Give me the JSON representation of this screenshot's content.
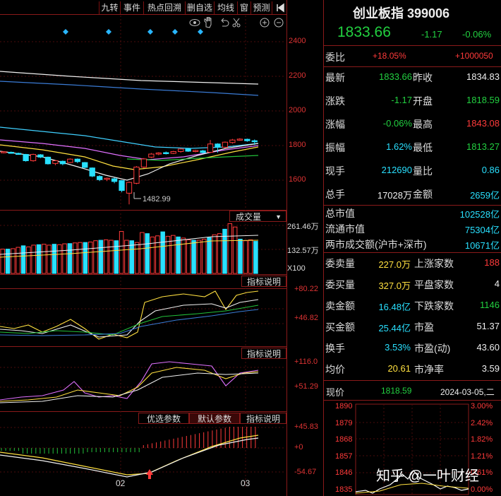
{
  "toolbar": {
    "items": [
      "九转",
      "事件",
      "热点回溯",
      "删自选",
      "均线",
      "窗",
      "预测"
    ],
    "collapse_icon": "panel-collapse-icon"
  },
  "chart_tools": [
    "eye-icon",
    "hand-icon",
    "undo-icon",
    "scissors-icon",
    "zoom-in-icon",
    "zoom-out-icon"
  ],
  "chart_data": [
    {
      "type": "candlestick",
      "title": "",
      "y_ticks": [
        "2400",
        "2200",
        "2000",
        "1800",
        "1600"
      ],
      "ylim": [
        1480,
        2460
      ],
      "low_annotation": "1482.99",
      "candles": [
        {
          "o": 1770,
          "c": 1775,
          "h": 1778,
          "l": 1766
        },
        {
          "o": 1772,
          "c": 1768,
          "h": 1776,
          "l": 1764
        },
        {
          "o": 1766,
          "c": 1762,
          "h": 1770,
          "l": 1758
        },
        {
          "o": 1760,
          "c": 1725,
          "h": 1763,
          "l": 1720
        },
        {
          "o": 1725,
          "c": 1760,
          "h": 1764,
          "l": 1720
        },
        {
          "o": 1758,
          "c": 1745,
          "h": 1762,
          "l": 1740
        },
        {
          "o": 1745,
          "c": 1708,
          "h": 1748,
          "l": 1704
        },
        {
          "o": 1710,
          "c": 1725,
          "h": 1728,
          "l": 1700
        },
        {
          "o": 1722,
          "c": 1708,
          "h": 1726,
          "l": 1700
        },
        {
          "o": 1715,
          "c": 1734,
          "h": 1738,
          "l": 1712
        },
        {
          "o": 1734,
          "c": 1720,
          "h": 1738,
          "l": 1712
        },
        {
          "o": 1715,
          "c": 1688,
          "h": 1718,
          "l": 1684
        },
        {
          "o": 1685,
          "c": 1640,
          "h": 1688,
          "l": 1634
        },
        {
          "o": 1638,
          "c": 1620,
          "h": 1645,
          "l": 1612
        },
        {
          "o": 1622,
          "c": 1628,
          "h": 1632,
          "l": 1612
        },
        {
          "o": 1625,
          "c": 1610,
          "h": 1632,
          "l": 1600
        },
        {
          "o": 1615,
          "c": 1560,
          "h": 1618,
          "l": 1550
        },
        {
          "o": 1545,
          "c": 1605,
          "h": 1610,
          "l": 1483
        },
        {
          "o": 1600,
          "c": 1690,
          "h": 1695,
          "l": 1595
        },
        {
          "o": 1690,
          "c": 1735,
          "h": 1740,
          "l": 1684
        },
        {
          "o": 1745,
          "c": 1762,
          "h": 1768,
          "l": 1740
        },
        {
          "o": 1762,
          "c": 1768,
          "h": 1772,
          "l": 1756
        },
        {
          "o": 1770,
          "c": 1766,
          "h": 1776,
          "l": 1760
        },
        {
          "o": 1766,
          "c": 1776,
          "h": 1780,
          "l": 1762
        },
        {
          "o": 1776,
          "c": 1790,
          "h": 1794,
          "l": 1770
        },
        {
          "o": 1790,
          "c": 1778,
          "h": 1796,
          "l": 1774
        },
        {
          "o": 1778,
          "c": 1782,
          "h": 1786,
          "l": 1772
        },
        {
          "o": 1780,
          "c": 1770,
          "h": 1785,
          "l": 1765
        },
        {
          "o": 1772,
          "c": 1818,
          "h": 1840,
          "l": 1768
        },
        {
          "o": 1818,
          "c": 1800,
          "h": 1822,
          "l": 1770
        },
        {
          "o": 1800,
          "c": 1828,
          "h": 1832,
          "l": 1796
        },
        {
          "o": 1826,
          "c": 1840,
          "h": 1846,
          "l": 1820
        },
        {
          "o": 1840,
          "c": 1845,
          "h": 1850,
          "l": 1836
        },
        {
          "o": 1844,
          "c": 1836,
          "h": 1848,
          "l": 1830
        },
        {
          "o": 1836,
          "c": 1833,
          "h": 1843,
          "l": 1813
        }
      ]
    },
    {
      "type": "bar",
      "title": "成交量",
      "y_ticks": [
        "261.46万",
        "132.57万",
        "X100"
      ],
      "values": [
        110,
        110,
        112,
        118,
        125,
        120,
        128,
        130,
        132,
        128,
        132,
        130,
        134,
        135,
        138,
        140,
        140,
        142,
        148,
        150,
        152,
        150,
        148,
        190,
        150,
        148,
        140,
        185,
        180,
        165,
        170,
        188,
        168,
        172,
        165,
        160,
        152,
        150,
        150,
        155,
        162,
        175,
        180,
        200,
        225,
        210,
        155,
        148,
        152,
        145
      ]
    }
  ],
  "panels": {
    "volume_label": "成交量",
    "volume_ticks": [
      "261.46万",
      "132.57万",
      "X100"
    ],
    "ind1_button": "指标说明",
    "ind1_ticks": [
      "+80.22",
      "+46.82"
    ],
    "ind2_button": "指标说明",
    "ind2_ticks": [
      "+116.0",
      "+51.29"
    ],
    "ind3_buttons": [
      "优选参数",
      "默认参数",
      "指标说明"
    ],
    "ind3_ticks": [
      "+45.83",
      "+0",
      "-54.67"
    ],
    "x_labels": [
      "02",
      "03"
    ]
  },
  "quote": {
    "title": "创业板指 399006",
    "price": "1833.66",
    "change": "-1.17",
    "change_pct": "-0.06%",
    "weibi_label": "委比",
    "weibi_pct": "+18.05%",
    "weibi_val": "+1000050",
    "rows": [
      {
        "l1": "最新",
        "v1": "1833.66",
        "l2": "昨收",
        "v2": "1834.83"
      },
      {
        "l1": "涨跌",
        "v1": "-1.17",
        "l2": "开盘",
        "v2": "1818.59"
      },
      {
        "l1": "涨幅",
        "v1": "-0.06%",
        "l2": "最高",
        "v2": "1843.08"
      },
      {
        "l1": "振幅",
        "v1": "1.62%",
        "l2": "最低",
        "v2": "1813.27"
      },
      {
        "l1": "现手",
        "v1": "212690",
        "l2": "量比",
        "v2": "0.86"
      },
      {
        "l1": "总手",
        "v1": "17028万",
        "l2": "金额",
        "v2": "2659亿"
      }
    ],
    "mv_rows": [
      {
        "l": "总市值",
        "v": "102528亿"
      },
      {
        "l": "流通市值",
        "v": "75304亿"
      },
      {
        "l": "两市成交额(沪市+深市)",
        "v": "10671亿"
      }
    ],
    "order_rows": [
      {
        "l1": "委卖量",
        "v1": "227.0万",
        "l2": "上涨家数",
        "v2": "188"
      },
      {
        "l1": "委买量",
        "v1": "327.0万",
        "l2": "平盘家数",
        "v2": "4"
      },
      {
        "l1": "卖金额",
        "v1": "16.48亿",
        "l2": "下跌家数",
        "v2": "1146"
      },
      {
        "l1": "买金额",
        "v1": "25.44亿",
        "l2": "市盈",
        "v2": "51.37"
      },
      {
        "l1": "换手",
        "v1": "3.53%",
        "l2": "市盈(动)",
        "v2": "43.60"
      },
      {
        "l1": "均价",
        "v1": "20.61",
        "l2": "市净率",
        "v2": "3.59"
      }
    ],
    "now_label": "现价",
    "now_val": "1818.59",
    "date": "2024-03-05,二",
    "mini_left": [
      "1890",
      "1879",
      "1868",
      "1857",
      "1846",
      "1835"
    ],
    "mini_right": [
      "3.00%",
      "2.42%",
      "1.82%",
      "1.21%",
      "0.61%",
      "0.00%"
    ]
  },
  "watermark": "知乎 @一叶财经",
  "colors": {
    "up": "#ff3a3a",
    "down": "#29e0ff",
    "frame": "#8a1a1a",
    "price_green": "#22d040"
  }
}
